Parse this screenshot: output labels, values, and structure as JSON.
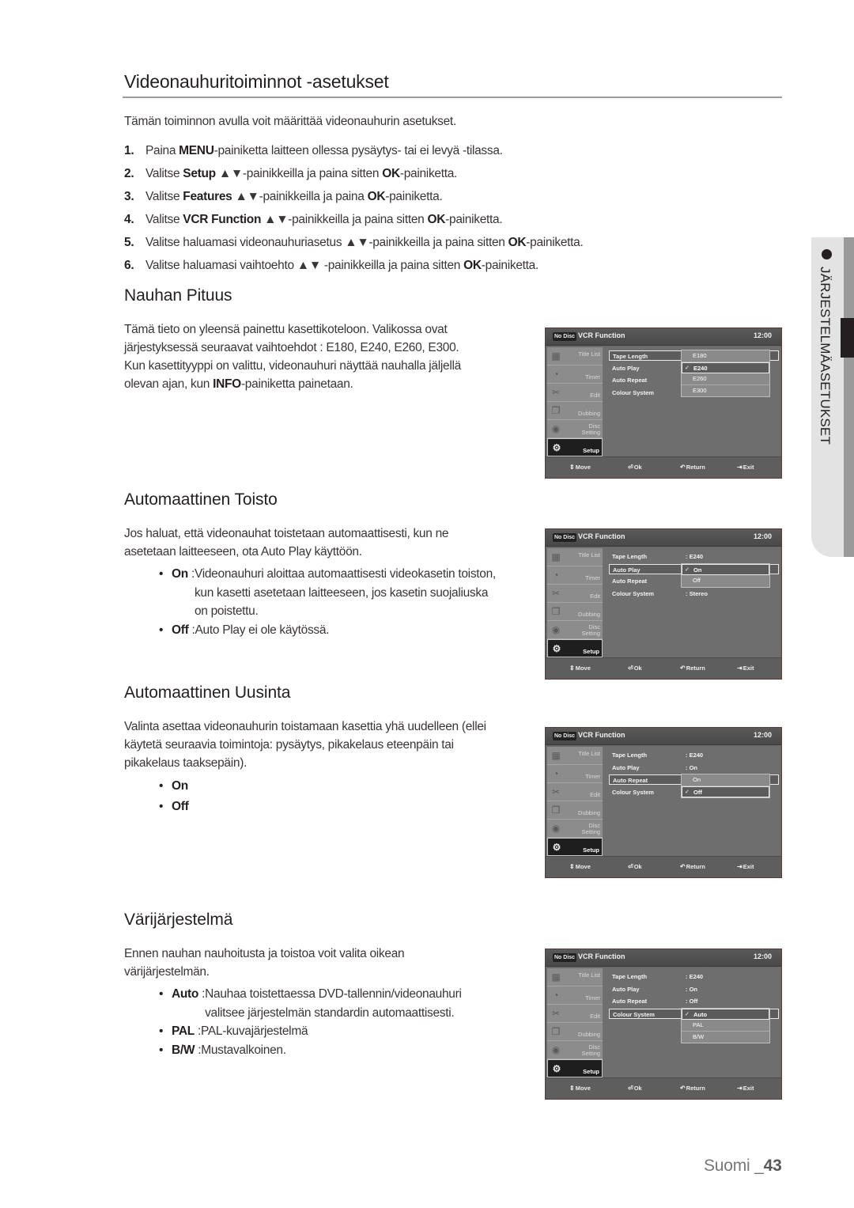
{
  "page": {
    "title": "Videonauhuritoiminnot -asetukset",
    "intro": "Tämän toiminnon avulla voit määrittää videonauhurin asetukset.",
    "steps": [
      {
        "num": "1.",
        "pre": "Paina ",
        "key": "MENU",
        "post": "-painiketta laitteen ollessa pysäytys- tai ei levyä -tilassa.",
        "ok": "",
        "tail": ""
      },
      {
        "num": "2.",
        "pre": "Valitse ",
        "key": "Setup",
        "post": " ▲▼-painikkeilla ja paina sitten ",
        "ok": "OK",
        "tail": "-painiketta."
      },
      {
        "num": "3.",
        "pre": "Valitse ",
        "key": "Features",
        "post": " ▲▼-painikkeilla ja paina ",
        "ok": "OK",
        "tail": "-painiketta."
      },
      {
        "num": "4.",
        "pre": "Valitse ",
        "key": "VCR Function",
        "post": " ▲▼-painikkeilla ja paina sitten ",
        "ok": "OK",
        "tail": "-painiketta."
      },
      {
        "num": "5.",
        "pre": "Valitse haluamasi videonauhuriasetus ",
        "key": "",
        "post": "▲▼-painikkeilla ja paina sitten ",
        "ok": "OK",
        "tail": "-painiketta."
      },
      {
        "num": "6.",
        "pre": "Valitse haluamasi vaihtoehto ",
        "key": "",
        "post": "▲▼ -painikkeilla ja paina sitten ",
        "ok": "OK",
        "tail": "-painiketta."
      }
    ],
    "side_tab": "JÄRJESTELMÄASETUKSET",
    "footer": {
      "lang": "Suomi _",
      "page": "43"
    }
  },
  "sections": [
    {
      "heading": "Nauhan Pituus",
      "text_lines": [
        "Tämä tieto on yleensä painettu kasettikoteloon. Valikossa ovat",
        "järjestyksessä seuraavat vaihtoehdot : E180, E240, E260, E300.",
        "Kun kasettityyppi on valittu, videonauhuri näyttää nauhalla jäljellä"
      ],
      "last_line": {
        "pre": "olevan ajan, kun ",
        "key": "INFO",
        "post": "-painiketta painetaan."
      }
    },
    {
      "heading": "Automaattinen Toisto",
      "text_lines": [
        "Jos haluat, että videonauhat toistetaan automaattisesti, kun ne",
        "asetetaan laitteeseen, ota Auto Play käyttöön."
      ],
      "bullets": [
        {
          "key": "On",
          "sep": " : ",
          "lines": [
            "Videonauhuri aloittaa automaattisesti videokasetin toiston,",
            "kun kasetti asetetaan laitteeseen, jos kasetin suojaliuska",
            "on poistettu."
          ]
        },
        {
          "key": "Off",
          "sep": " : ",
          "lines": [
            "Auto Play ei ole käytössä."
          ]
        }
      ]
    },
    {
      "heading": "Automaattinen Uusinta",
      "text_lines": [
        "Valinta asettaa videonauhurin toistamaan kasettia yhä uudelleen (ellei",
        "käytetä seuraavia toimintoja: pysäytys, pikakelaus eteenpäin tai",
        "pikakelaus taaksepäin)."
      ],
      "bullets": [
        {
          "key": "On"
        },
        {
          "key": "Off"
        }
      ]
    },
    {
      "heading": "Värijärjestelmä",
      "text_lines": [
        "Ennen nauhan nauhoitusta ja toistoa voit valita oikean",
        "värijärjestelmän."
      ],
      "bullets": [
        {
          "key": "Auto",
          "sep": " : ",
          "lines": [
            "Nauhaa toistettaessa DVD-tallennin/videonauhuri",
            "valitsee järjestelmän standardin automaattisesti."
          ]
        },
        {
          "key": "PAL",
          "sep": " : ",
          "lines": [
            "PAL-kuvajärjestelmä"
          ]
        },
        {
          "key": "B/W",
          "sep": " : ",
          "lines": [
            "Mustavalkoinen."
          ]
        }
      ]
    }
  ],
  "osd_common": {
    "no_disc": "No Disc",
    "title": "VCR Function",
    "clock": "12:00",
    "sidebar": [
      {
        "label": "Title List",
        "icon": "film-icon",
        "glyph": "▦"
      },
      {
        "label": "Timer",
        "icon": "clock-icon",
        "glyph": "◔"
      },
      {
        "label": "Edit",
        "icon": "scissors-icon",
        "glyph": "✂"
      },
      {
        "label": "Dubbing",
        "icon": "dubbing-icon",
        "glyph": "❐"
      },
      {
        "label1": "Disc",
        "label2": "Setting",
        "icon": "disc-icon",
        "glyph": "◉"
      },
      {
        "label": "Setup",
        "icon": "gear-icon",
        "glyph": "⚙",
        "active": true
      }
    ],
    "hints": [
      {
        "icon": "updown-icon",
        "glyph": "⇕",
        "label": "Move"
      },
      {
        "icon": "ok-icon",
        "glyph": "⏎",
        "label": "Ok"
      },
      {
        "icon": "return-icon",
        "glyph": "↶",
        "label": "Return"
      },
      {
        "icon": "exit-icon",
        "glyph": "⇥",
        "label": "Exit"
      }
    ],
    "row_labels": [
      "Tape Length",
      "Auto Play",
      "Auto Repeat",
      "Colour System"
    ]
  },
  "osd_screens": [
    {
      "selected_row": 0,
      "values": [
        "",
        "",
        "",
        ""
      ],
      "options": [
        "E180",
        "E240",
        "E260",
        "E300"
      ],
      "checked": 1
    },
    {
      "selected_row": 1,
      "values": [
        ": E240",
        "",
        "",
        ": Stereo"
      ],
      "options": [
        "On",
        "Off"
      ],
      "checked": 0
    },
    {
      "selected_row": 2,
      "values": [
        ": E240",
        ": On",
        "",
        ""
      ],
      "options": [
        "On",
        "Off"
      ],
      "checked": 1
    },
    {
      "selected_row": 3,
      "values": [
        ": E240",
        ": On",
        ": Off",
        ""
      ],
      "options": [
        "Auto",
        "PAL",
        "B/W"
      ],
      "checked": 0
    }
  ],
  "check_glyph": "✓"
}
